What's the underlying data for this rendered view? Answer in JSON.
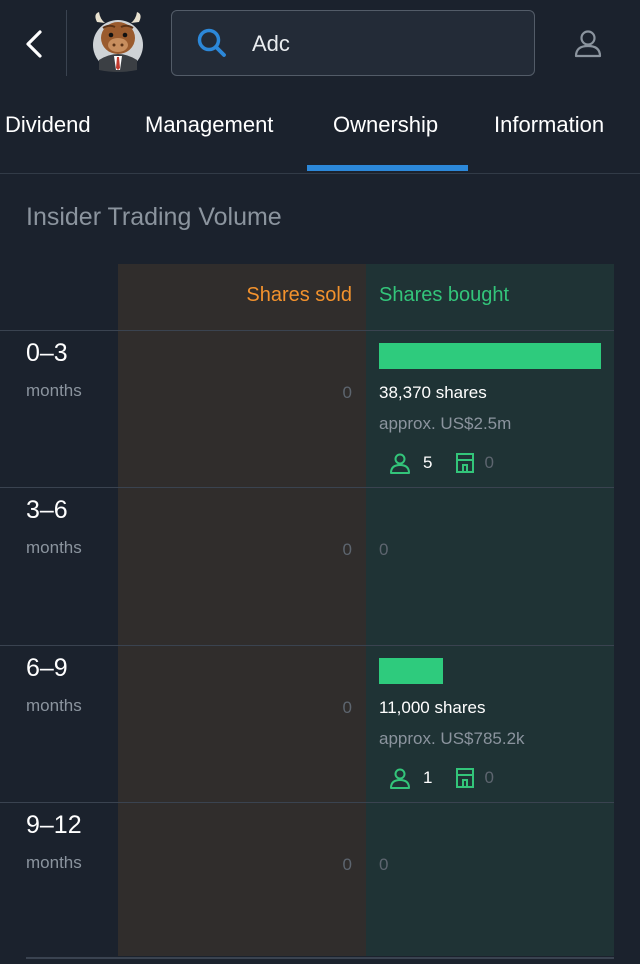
{
  "header": {
    "search_value": "Adc"
  },
  "tabs": [
    {
      "label": "Dividend"
    },
    {
      "label": "Management"
    },
    {
      "label": "Ownership"
    },
    {
      "label": "Information"
    }
  ],
  "section": {
    "title": "Insider Trading Volume",
    "col_sold": "Shares sold",
    "col_bought": "Shares bought"
  },
  "rows": [
    {
      "period": "0–3",
      "unit": "months",
      "sold": "0",
      "bought_fraction": 1.0,
      "shares": "38,370 shares",
      "approx": "approx. US$2.5m",
      "insiders": "5",
      "institutions": "0"
    },
    {
      "period": "3–6",
      "unit": "months",
      "sold": "0",
      "bought": "0"
    },
    {
      "period": "6–9",
      "unit": "months",
      "sold": "0",
      "bought_fraction": 0.287,
      "shares": "11,000 shares",
      "approx": "approx. US$785.2k",
      "insiders": "1",
      "institutions": "0"
    },
    {
      "period": "9–12",
      "unit": "months",
      "sold": "0",
      "bought": "0"
    }
  ],
  "colors": {
    "sold": "#f3922d",
    "bought": "#33c57a",
    "accent": "#2c88d9"
  },
  "icons": [
    "back-arrow-icon",
    "bull-avatar-icon",
    "search-icon",
    "user-icon",
    "person-icon",
    "building-icon"
  ]
}
